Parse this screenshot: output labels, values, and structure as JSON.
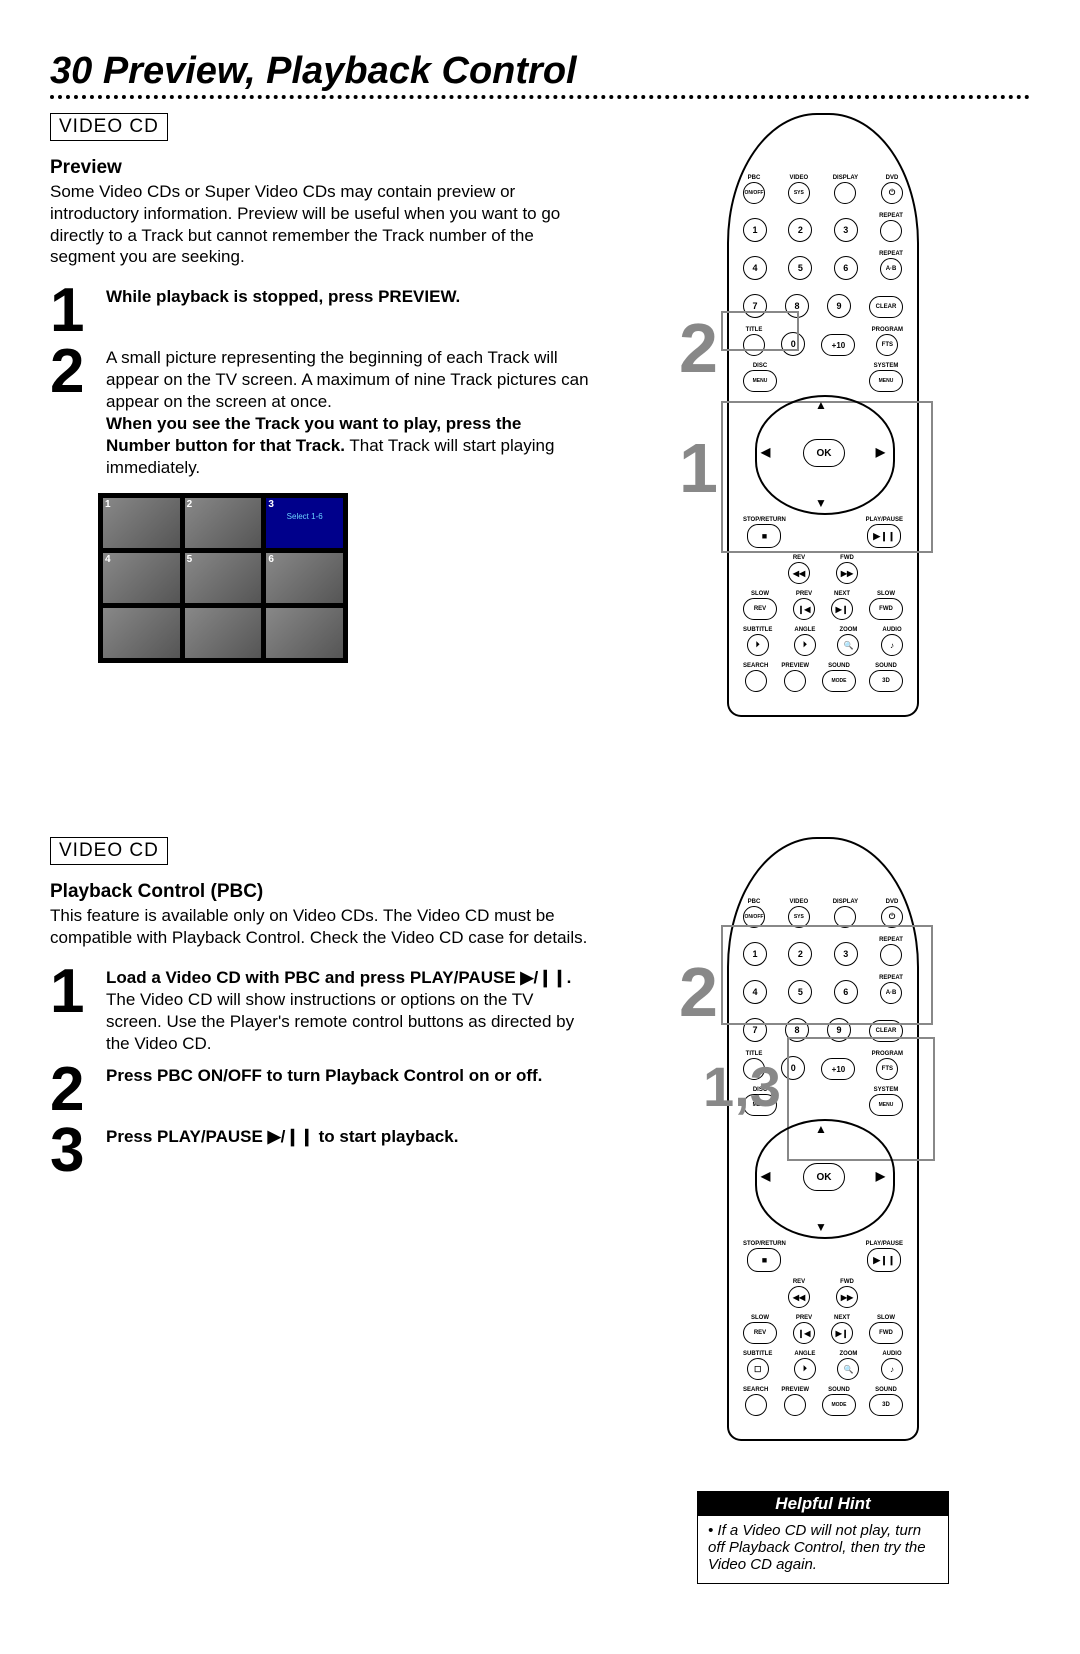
{
  "page_title": "30  Preview, Playback Control",
  "section1": {
    "badge": "VIDEO CD",
    "heading": "Preview",
    "intro": "Some Video CDs or Super Video CDs may contain preview or introductory information. Preview will be useful when you want to go directly to a Track but cannot remember the Track number of the segment you are seeking.",
    "step1": "While playback is stopped, press PREVIEW.",
    "step2a": "A small picture representing the beginning of each Track will appear on the TV screen. A maximum of nine Track pictures can appear on the screen at once.",
    "step2b_bold": "When you see the Track you want to play, press the Number button for that Track.",
    "step2b_rest": " That Track will start playing immediately.",
    "callout1": "1",
    "callout2": "2"
  },
  "section2": {
    "badge": "VIDEO CD",
    "heading": "Playback Control (PBC)",
    "intro": "This feature is available only on Video CDs. The Video CD must be compatible with Playback Control. Check the Video CD case for details.",
    "step1_bold": "Load a Video CD with PBC and press PLAY/PAUSE ▶/❙❙.",
    "step1_rest": " The Video CD will show instructions or options on the TV screen. Use the Player's remote control buttons as directed by the Video CD.",
    "step2": "Press PBC ON/OFF to turn Playback Control on or off.",
    "step3_a": "Press PLAY/PAUSE ",
    "step3_glyph": "▶/❙❙",
    "step3_b": " to start playback.",
    "callout1": "1,3",
    "callout2": "2"
  },
  "hint": {
    "title": "Helpful Hint",
    "body": "If a Video CD will not play, turn off Playback Control, then try the Video CD again."
  },
  "remote": {
    "row1": [
      "PBC",
      "VIDEO",
      "DISPLAY",
      "DVD"
    ],
    "row1b": [
      "ON/OFF",
      "SYS",
      "",
      ""
    ],
    "repeat": "REPEAT",
    "repeat_ab": "REPEAT",
    "ab": "A·B",
    "clear": "CLEAR",
    "title": "TITLE",
    "program": "PROGRAM",
    "fts": "FTS",
    "disc": "DISC",
    "menu": "MENU",
    "system": "SYSTEM",
    "ok": "OK",
    "stop_return": "STOP/RETURN",
    "play_pause": "PLAY/PAUSE",
    "rev": "REV",
    "fwd": "FWD",
    "slow": "SLOW",
    "prev": "PREV",
    "next": "NEXT",
    "slow2": "SLOW",
    "rev2": "REV",
    "fwd2": "FWD",
    "subtitle": "SUBTITLE",
    "angle": "ANGLE",
    "zoom": "ZOOM",
    "audio": "AUDIO",
    "search": "SEARCH",
    "preview": "PREVIEW",
    "sound": "SOUND",
    "mode": "MODE",
    "sound2": "SOUND",
    "threeD": "3D",
    "zero": "0",
    "plus10": "+10"
  }
}
